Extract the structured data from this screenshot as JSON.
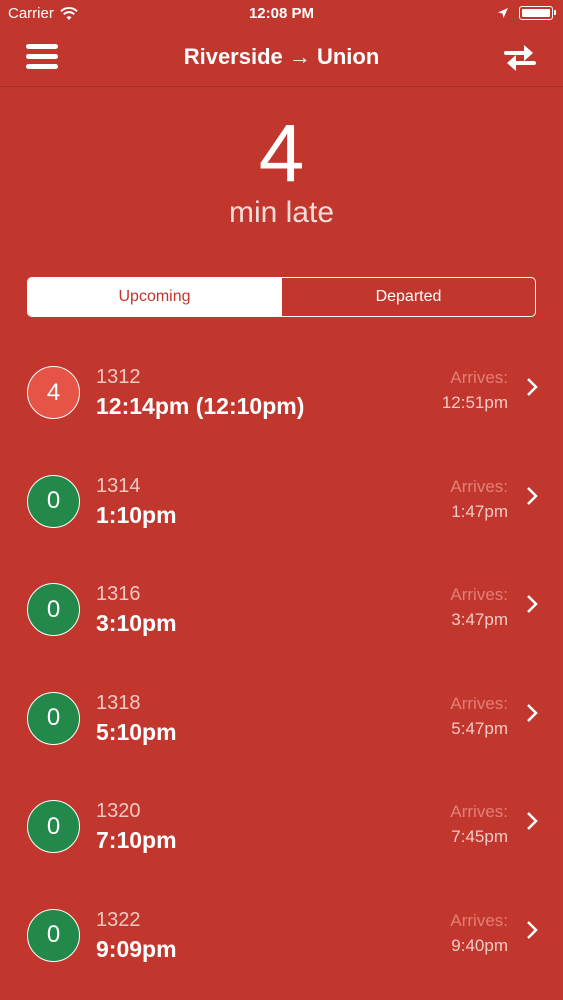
{
  "status_bar": {
    "carrier": "Carrier",
    "time": "12:08 PM"
  },
  "nav": {
    "title": "Riverside → Union"
  },
  "delay": {
    "minutes": "4",
    "label": "min late"
  },
  "tabs": [
    {
      "label": "Upcoming",
      "active": true
    },
    {
      "label": "Departed",
      "active": false
    }
  ],
  "colors": {
    "background": "#c2372d",
    "late_badge": "#e65448",
    "ontime_badge": "#22894a"
  },
  "trains": [
    {
      "delay": "4",
      "number": "1312",
      "departs": "12:14pm (12:10pm)",
      "arrives_label": "Arrives:",
      "arrives": "12:51pm"
    },
    {
      "delay": "0",
      "number": "1314",
      "departs": "1:10pm",
      "arrives_label": "Arrives:",
      "arrives": "1:47pm"
    },
    {
      "delay": "0",
      "number": "1316",
      "departs": "3:10pm",
      "arrives_label": "Arrives:",
      "arrives": "3:47pm"
    },
    {
      "delay": "0",
      "number": "1318",
      "departs": "5:10pm",
      "arrives_label": "Arrives:",
      "arrives": "5:47pm"
    },
    {
      "delay": "0",
      "number": "1320",
      "departs": "7:10pm",
      "arrives_label": "Arrives:",
      "arrives": "7:45pm"
    },
    {
      "delay": "0",
      "number": "1322",
      "departs": "9:09pm",
      "arrives_label": "Arrives:",
      "arrives": "9:40pm"
    }
  ]
}
